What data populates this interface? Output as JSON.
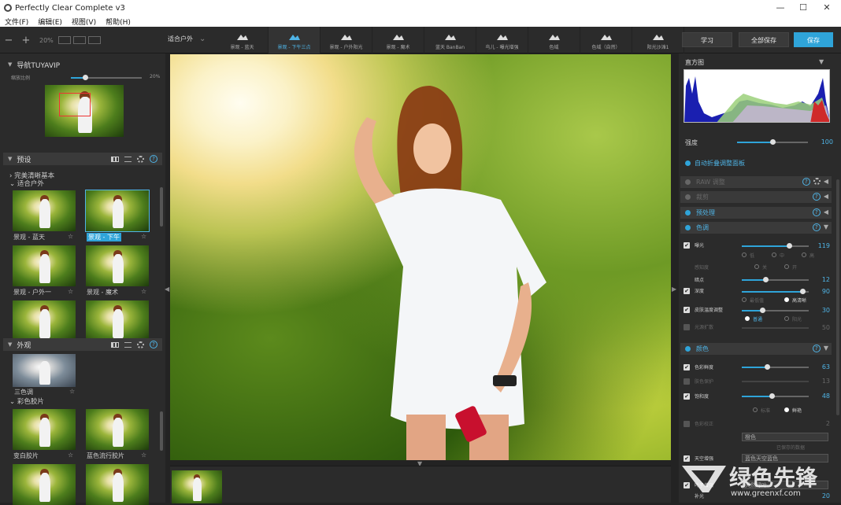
{
  "window": {
    "title": "Perfectly Clear Complete v3",
    "min": "—",
    "max": "☐",
    "close": "✕"
  },
  "menu": [
    "文件(F)",
    "编辑(E)",
    "视图(V)",
    "帮助(H)"
  ],
  "toolbar": {
    "zoom_out": "−",
    "zoom_in": "+",
    "zoom_pct": "20%",
    "preset_select": "适合户外",
    "presets": [
      {
        "label": "景观 - 蓝天",
        "icon": "mountain-icon"
      },
      {
        "label": "景观 - 下午三点",
        "icon": "landscape-icon"
      },
      {
        "label": "景观 - 户外阳光",
        "icon": "sun-icon"
      },
      {
        "label": "景观 - 魔术",
        "icon": "magic-wand-icon"
      },
      {
        "label": "蓝天 BanBan",
        "icon": "chat-icon"
      },
      {
        "label": "鸟儿 - 曝光增强",
        "icon": "leaf-icon"
      },
      {
        "label": "色域",
        "icon": "plant-icon"
      },
      {
        "label": "色域（自然）",
        "icon": "plant-icon"
      },
      {
        "label": "阳光沙滩1",
        "icon": "beach-icon"
      }
    ],
    "learn": "学习",
    "save_all": "全部保存",
    "save": "保存"
  },
  "left": {
    "navigator": {
      "title": "导航TUYAVIP",
      "zoom_label": "缩放比例",
      "zoom_value": "20%",
      "zoom_fraction": 0.2
    },
    "presets": {
      "title": "预设",
      "tree": [
        "完美清晰基本",
        "适合户外"
      ],
      "thumbs": [
        {
          "label": "景观 - 蓝天",
          "selected": false
        },
        {
          "label": "景观 - 下午",
          "selected": true
        },
        {
          "label": "景观 - 户外一",
          "selected": false
        },
        {
          "label": "景观 - 魔术",
          "selected": false
        },
        {
          "label": "",
          "selected": false
        },
        {
          "label": "",
          "selected": false
        }
      ]
    },
    "looks": {
      "title": "外观",
      "first": "三色调",
      "tree": "彩色胶片",
      "thumbs": [
        {
          "label": "变白胶片"
        },
        {
          "label": "蓝色流行胶片"
        },
        {
          "label": ""
        },
        {
          "label": ""
        }
      ]
    },
    "star": "☆"
  },
  "right": {
    "histogram": {
      "title": "直方图"
    },
    "strength": {
      "label": "强度",
      "value": "100",
      "fraction": 1.0
    },
    "auto": "自动折叠调整面板",
    "sections": {
      "raw": "RAW 调整",
      "crop": "裁剪",
      "pre": "预处理",
      "tone": "色调",
      "color": "颜色"
    },
    "tone": {
      "exposure": {
        "label": "曝光",
        "value": "119",
        "fraction": 0.7
      },
      "exposure_opts": [
        "低",
        "中",
        "高"
      ],
      "depth": {
        "label": "感知度",
        "opts": [
          "关",
          "开"
        ]
      },
      "dark": {
        "label": "暗点",
        "value": "12",
        "fraction": 0.35
      },
      "depth2": {
        "label": "深度",
        "value": "90",
        "fraction": 0.9
      },
      "depth2_opts": [
        "最低值",
        "高清晰"
      ],
      "skin": {
        "label": "皮肤温度调整",
        "value": "30",
        "fraction": 0.3
      },
      "skin_opts": [
        "普通",
        "阳光"
      ],
      "highlight": {
        "label": "光源扩散",
        "value": "50"
      }
    },
    "color": {
      "vibrancy": {
        "label": "色彩鲜度",
        "value": "63",
        "fraction": 0.38
      },
      "skintone": {
        "label": "肤色保护",
        "value": "13"
      },
      "vivid": {
        "label": "饱和度",
        "value": "48",
        "fraction": 0.45
      },
      "vivid_opts": [
        "标准",
        "鲜艳"
      ],
      "tint": {
        "label": "色彩校正",
        "value": "2"
      },
      "tint_mode": "橙色",
      "note": "已保存的数据",
      "bgc": {
        "label": "天空增强",
        "mode": "蓝色天空蓝色"
      },
      "green": {
        "label": "叶子增强",
        "mode": "天然绿叶"
      },
      "fill": {
        "label": "补光",
        "value": "20"
      }
    }
  },
  "watermark": {
    "brand": "绿色先锋",
    "url": "www.greenxf.com"
  }
}
